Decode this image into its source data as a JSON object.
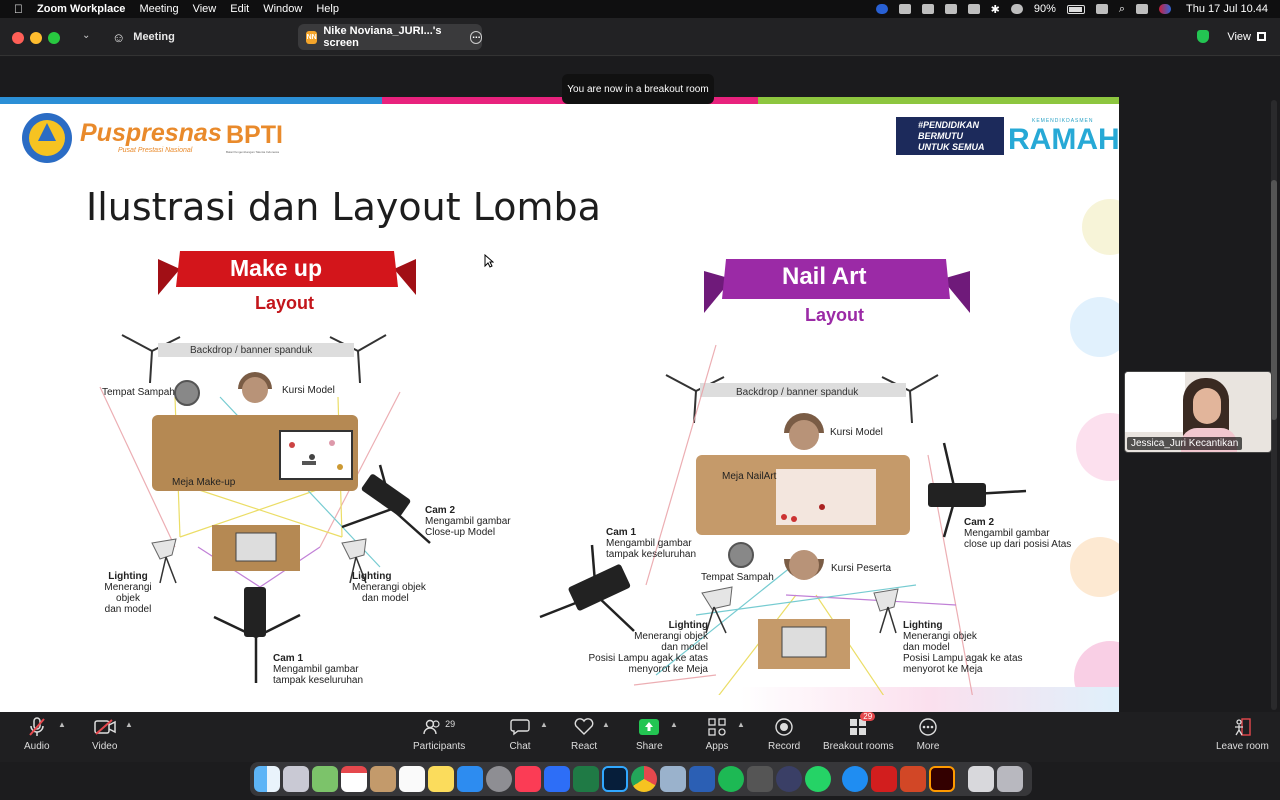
{
  "menubar": {
    "app": "Zoom Workplace",
    "items": [
      "Meeting",
      "View",
      "Edit",
      "Window",
      "Help"
    ],
    "battery": "90%",
    "datetime": "Thu 17 Jul  10.44"
  },
  "window": {
    "meeting_tab": "Meeting",
    "share_tab": "Nike Noviana_JURI...'s screen",
    "share_badge": "NN",
    "view_label": "View"
  },
  "toast": "You are now in a breakout room",
  "slide": {
    "logo_puspresnas": "Puspresnas",
    "logo_puspresnas_sub": "Pusat Prestasi Nasional",
    "logo_bpti": "BPTI",
    "logo_bpti_sub": "Balai Pengembangan Talenta Indonesia",
    "hashtag_line1": "#PENDIDIKAN",
    "hashtag_line2": "BERMUTU",
    "hashtag_line3": "UNTUK SEMUA",
    "kemendikdasmen": "KEMENDIKDASMEN",
    "ramah": "RAMAH",
    "title": "Ilustrasi dan Layout Lomba",
    "left": {
      "banner": "Make up",
      "subtitle": "Layout",
      "backdrop": "Backdrop / banner spanduk",
      "trash": "Tempat Sampah",
      "chair": "Kursi Model",
      "table": "Meja Make-up",
      "cam2_title": "Cam 2",
      "cam2_desc1": "Mengambil gambar",
      "cam2_desc2": "Close-up Model",
      "light_l_title": "Lighting",
      "light_l_desc1": "Menerangi objek",
      "light_l_desc2": "dan model",
      "light_r_title": "Lighting",
      "light_r_desc1": "Menerangi objek",
      "light_r_desc2": "dan model",
      "cam1_title": "Cam 1",
      "cam1_desc1": "Mengambil gambar",
      "cam1_desc2": "tampak keseluruhan"
    },
    "right": {
      "banner": "Nail Art",
      "subtitle": "Layout",
      "backdrop": "Backdrop / banner spanduk",
      "chair": "Kursi Model",
      "table": "Meja NailArt",
      "cam1_title": "Cam 1",
      "cam1_desc1": "Mengambil gambar",
      "cam1_desc2": "tampak keseluruhan",
      "cam2_title": "Cam 2",
      "cam2_desc1": "Mengambil gambar",
      "cam2_desc2": "close up dari posisi Atas",
      "trash": "Tempat Sampah",
      "chair2": "Kursi Peserta",
      "light_l_title": "Lighting",
      "light_l_desc1": "Menerangi objek",
      "light_l_desc2": "dan model",
      "light_l_desc3": "Posisi Lampu agak ke atas",
      "light_l_desc4": "menyorot ke Meja",
      "light_r_title": "Lighting",
      "light_r_desc1": "Menerangi objek",
      "light_r_desc2": "dan model",
      "light_r_desc3": "Posisi Lampu agak ke atas",
      "light_r_desc4": "menyorot ke Meja"
    }
  },
  "participant_thumb": {
    "name": "Jessica_Juri Kecantikan"
  },
  "toolbar": {
    "audio": "Audio",
    "video": "Video",
    "participants": "Participants",
    "participants_count": "29",
    "chat": "Chat",
    "react": "React",
    "share": "Share",
    "apps": "Apps",
    "record": "Record",
    "breakout": "Breakout rooms",
    "breakout_badge": "29",
    "more": "More",
    "leave": "Leave room"
  },
  "colors": {
    "stripe": [
      "#2b8fd6",
      "#e8227d",
      "#8dc63f"
    ],
    "makeup_banner": "#d3151b",
    "nail_banner": "#9b2aa6",
    "share_green": "#23c552"
  },
  "dock_icons": [
    "finder-icon",
    "launchpad-icon",
    "maps-icon",
    "calendar-icon",
    "contacts-icon",
    "reminders-icon",
    "notes-icon",
    "appstore-icon",
    "settings-icon",
    "music-icon",
    "zoom-icon",
    "excel-icon",
    "photoshop-icon",
    "chrome-icon",
    "preview-icon",
    "word-icon",
    "spotify-icon",
    "calculator-icon",
    "screenrecord-icon",
    "whatsapp-icon",
    "safari-icon",
    "acrobat-icon",
    "powerpoint-icon",
    "illustrator-icon",
    "documents-icon",
    "trash-icon"
  ]
}
